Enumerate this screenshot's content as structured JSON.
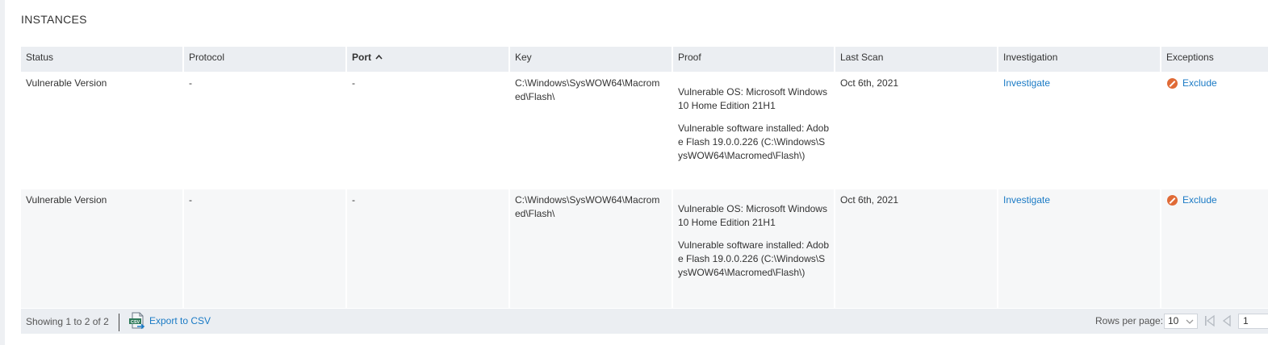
{
  "section": {
    "title": "INSTANCES"
  },
  "table": {
    "columns": [
      "Status",
      "Protocol",
      "Port",
      "Key",
      "Proof",
      "Last Scan",
      "Investigation",
      "Exceptions"
    ],
    "sorted_column": "Port",
    "sort_indicator": "ascending",
    "rows": [
      {
        "status": "Vulnerable Version",
        "protocol": "-",
        "port": "-",
        "key": "C:\\Windows\\SysWOW64\\Macromed\\Flash\\",
        "proof_os": "Vulnerable OS: Microsoft Windows 10 Home Edition 21H1",
        "proof_software": "Vulnerable software installed: Adobe Flash 19.0.0.226 (C:\\Windows\\SysWOW64\\Macromed\\Flash\\)",
        "last_scan": "Oct 6th, 2021",
        "investigation": "Investigate",
        "exception": "Exclude"
      },
      {
        "status": "Vulnerable Version",
        "protocol": "-",
        "port": "-",
        "key": "C:\\Windows\\SysWOW64\\Macromed\\Flash\\",
        "proof_os": "Vulnerable OS: Microsoft Windows 10 Home Edition 21H1",
        "proof_software": "Vulnerable software installed: Adobe Flash 19.0.0.226 (C:\\Windows\\SysWOW64\\Macromed\\Flash\\)",
        "last_scan": "Oct 6th, 2021",
        "investigation": "Investigate",
        "exception": "Exclude"
      }
    ]
  },
  "footer": {
    "showing": "Showing 1 to 2 of 2",
    "export_label": "Export to CSV",
    "csv_icon_text": "CSV",
    "rows_per_page_label": "Rows per page:",
    "rows_per_page_value": "10",
    "page_value": "1"
  },
  "colors": {
    "link": "#1a7ac5",
    "exclude_icon": "#e06a36",
    "header_bg": "#ebeef2",
    "alt_row_bg": "#f6f7f8"
  }
}
